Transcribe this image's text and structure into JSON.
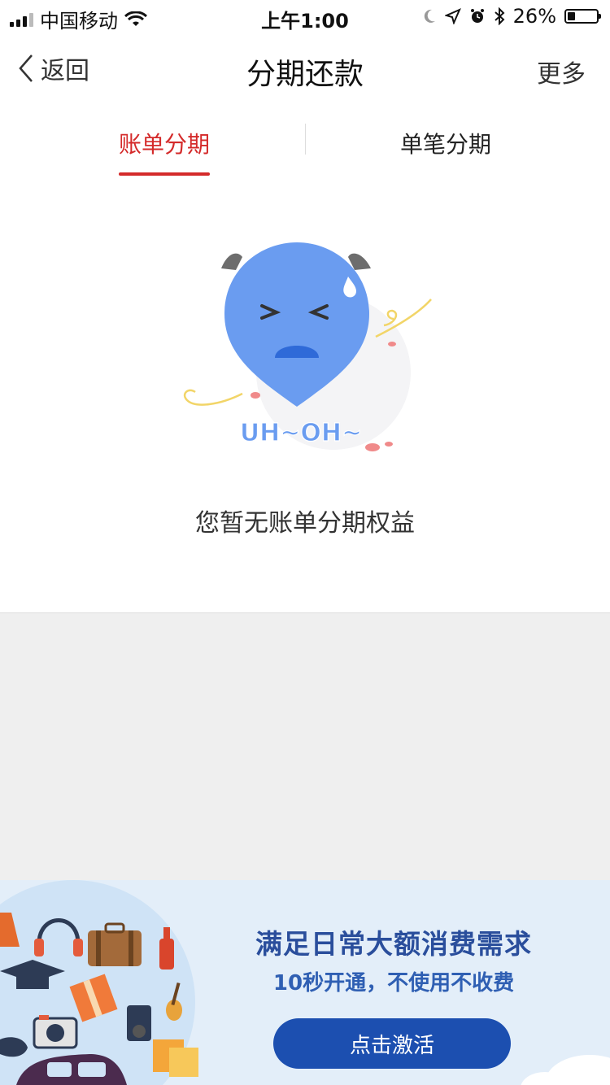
{
  "status_bar": {
    "carrier": "中国移动",
    "time": "上午1:00",
    "battery": "26%",
    "battery_level": 0.26,
    "icons": [
      "signal-icon",
      "wifi-icon",
      "moon-icon",
      "location-icon",
      "alarm-icon",
      "bluetooth-icon",
      "battery-icon"
    ]
  },
  "nav": {
    "back_label": "返回",
    "title": "分期还款",
    "more_label": "更多"
  },
  "tabs": [
    {
      "label": "账单分期",
      "active": true
    },
    {
      "label": "单笔分期",
      "active": false
    }
  ],
  "empty_state": {
    "illustration_text": "UH~OH~",
    "message": "您暂无账单分期权益"
  },
  "banner": {
    "title": "满足日常大额消费需求",
    "subtitle": "10秒开通，不使用不收费",
    "button_label": "点击激活"
  },
  "colors": {
    "accent_red": "#d42a2a",
    "banner_blue": "#1c4fb0",
    "banner_text": "#2a4e9c",
    "mascot_blue": "#6a9cf0"
  }
}
